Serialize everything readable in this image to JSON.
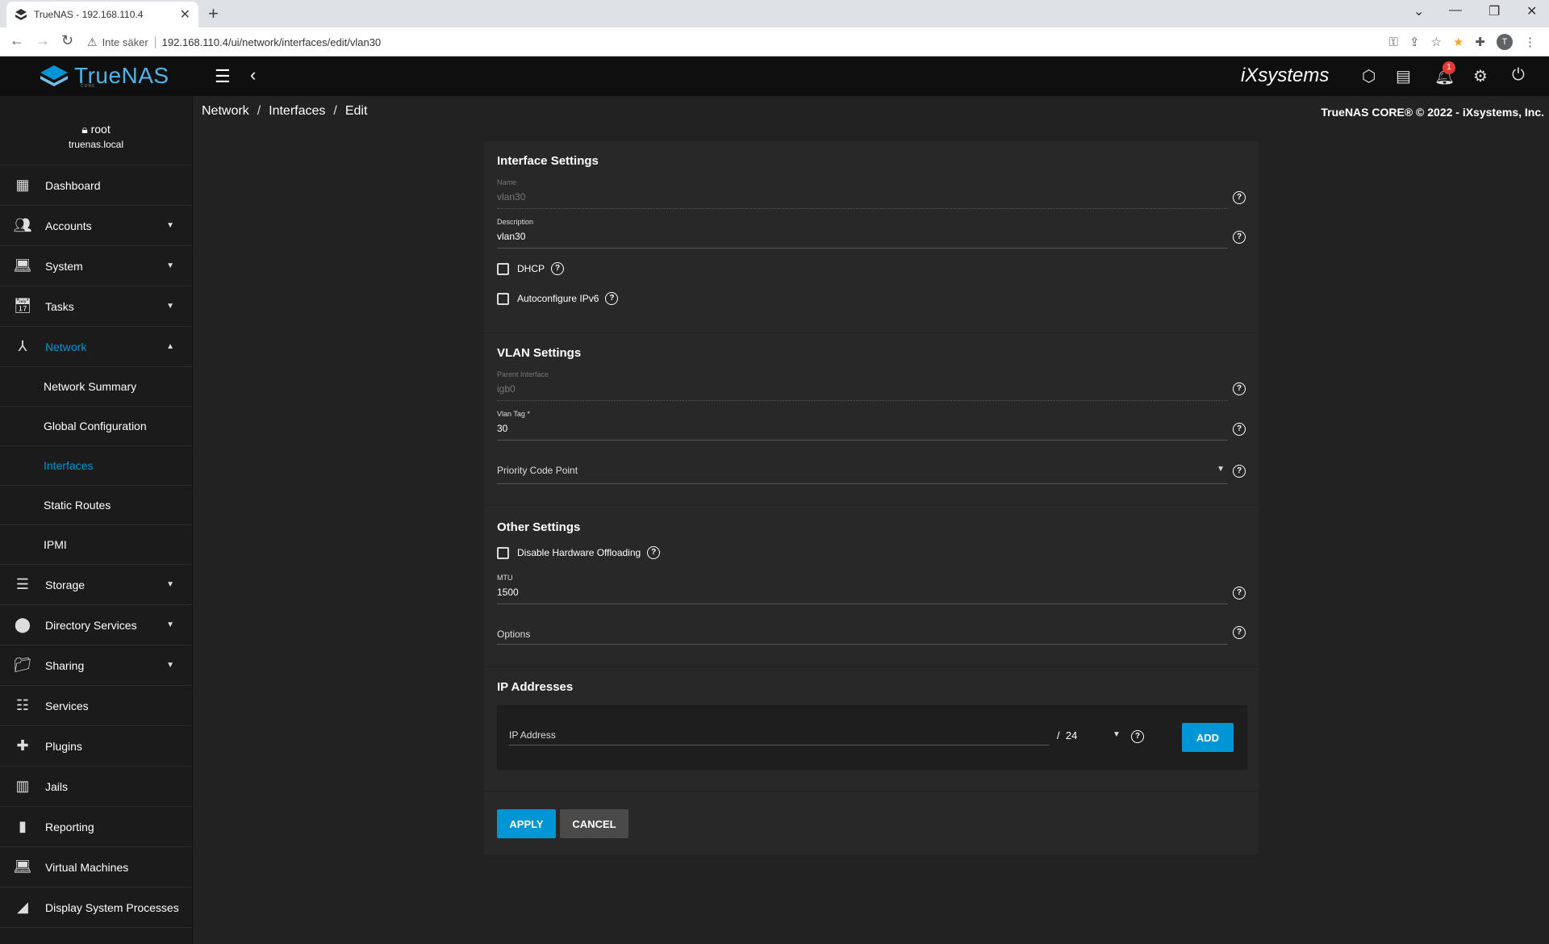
{
  "browser": {
    "tab_title": "TrueNAS - 192.168.110.4",
    "insecure_label": "Inte säker",
    "url": "192.168.110.4/ui/network/interfaces/edit/vlan30",
    "profile_initial": "T"
  },
  "topbar": {
    "logo_text": "TrueNAS",
    "logo_sub": "CORE",
    "ix_logo": "iXsystems",
    "notification_count": "1"
  },
  "breadcrumb": {
    "items": [
      "Network",
      "Interfaces",
      "Edit"
    ],
    "separator": "/"
  },
  "copyright": "TrueNAS CORE® © 2022 - iXsystems, Inc.",
  "user": {
    "name": "root",
    "host": "truenas.local"
  },
  "sidebar": {
    "items": [
      {
        "label": "Dashboard",
        "icon": "dashboard-icon"
      },
      {
        "label": "Accounts",
        "icon": "people-icon"
      },
      {
        "label": "System",
        "icon": "laptop-icon"
      },
      {
        "label": "Tasks",
        "icon": "calendar-icon"
      },
      {
        "label": "Network",
        "icon": "network-icon"
      },
      {
        "label": "Storage",
        "icon": "storage-icon"
      },
      {
        "label": "Directory Services",
        "icon": "directory-icon"
      },
      {
        "label": "Sharing",
        "icon": "folder-share-icon"
      },
      {
        "label": "Services",
        "icon": "tune-icon"
      },
      {
        "label": "Plugins",
        "icon": "puzzle-icon"
      },
      {
        "label": "Jails",
        "icon": "jail-icon"
      },
      {
        "label": "Reporting",
        "icon": "chart-icon"
      },
      {
        "label": "Virtual Machines",
        "icon": "laptop-icon"
      },
      {
        "label": "Display System Processes",
        "icon": "process-icon"
      }
    ],
    "network_sub": [
      "Network Summary",
      "Global Configuration",
      "Interfaces",
      "Static Routes",
      "IPMI"
    ],
    "active_sub": "Interfaces"
  },
  "form": {
    "interface_settings": {
      "title": "Interface Settings",
      "name_label": "Name",
      "name_value": "vlan30",
      "description_label": "Description",
      "description_value": "vlan30",
      "dhcp_label": "DHCP",
      "ipv6_label": "Autoconfigure IPv6"
    },
    "vlan_settings": {
      "title": "VLAN Settings",
      "parent_label": "Parent Interface",
      "parent_value": "igb0",
      "tag_label": "Vlan Tag *",
      "tag_value": "30",
      "pcp_label": "Priority Code Point"
    },
    "other_settings": {
      "title": "Other Settings",
      "offload_label": "Disable Hardware Offloading",
      "mtu_label": "MTU",
      "mtu_value": "1500",
      "options_label": "Options"
    },
    "ip_addresses": {
      "title": "IP Addresses",
      "ip_label": "IP Address",
      "mask_separator": "/",
      "mask_value": "24",
      "add_label": "ADD"
    },
    "apply_label": "APPLY",
    "cancel_label": "CANCEL"
  },
  "colors": {
    "accent": "#0095d5",
    "background": "#222222",
    "card": "#282828",
    "sidebar": "#1b1b1b"
  }
}
